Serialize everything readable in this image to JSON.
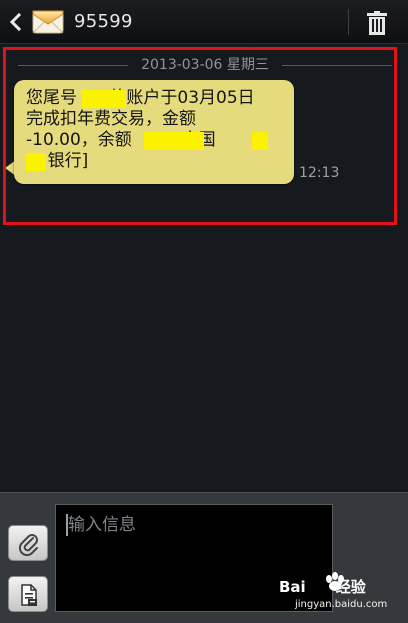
{
  "header": {
    "contact_number": "95599",
    "back_icon": "chevron-left-icon",
    "contact_icon": "envelope-icon",
    "delete_icon": "trash-icon"
  },
  "conversation": {
    "date_separator": "2013-03-06 星期三",
    "messages": [
      {
        "lines": [
          "您尾号      的账户于03月05日",
          "完成扣年费交易，金额",
          "-10.00，余额        [中国",
          "    银行]"
        ],
        "time": "12:13",
        "redacted": true
      }
    ],
    "highlight_color": "#e0121b"
  },
  "compose": {
    "placeholder": "输入信息",
    "attach_icon": "paperclip-icon",
    "template_icon": "document-icon"
  },
  "watermark": {
    "logo": "Bai",
    "logo_suffix": "经验",
    "url": "jingyan.baidu.com"
  },
  "colors": {
    "bubble": "#e5db7c",
    "redaction": "#fbf200",
    "background": "#161a1e"
  }
}
